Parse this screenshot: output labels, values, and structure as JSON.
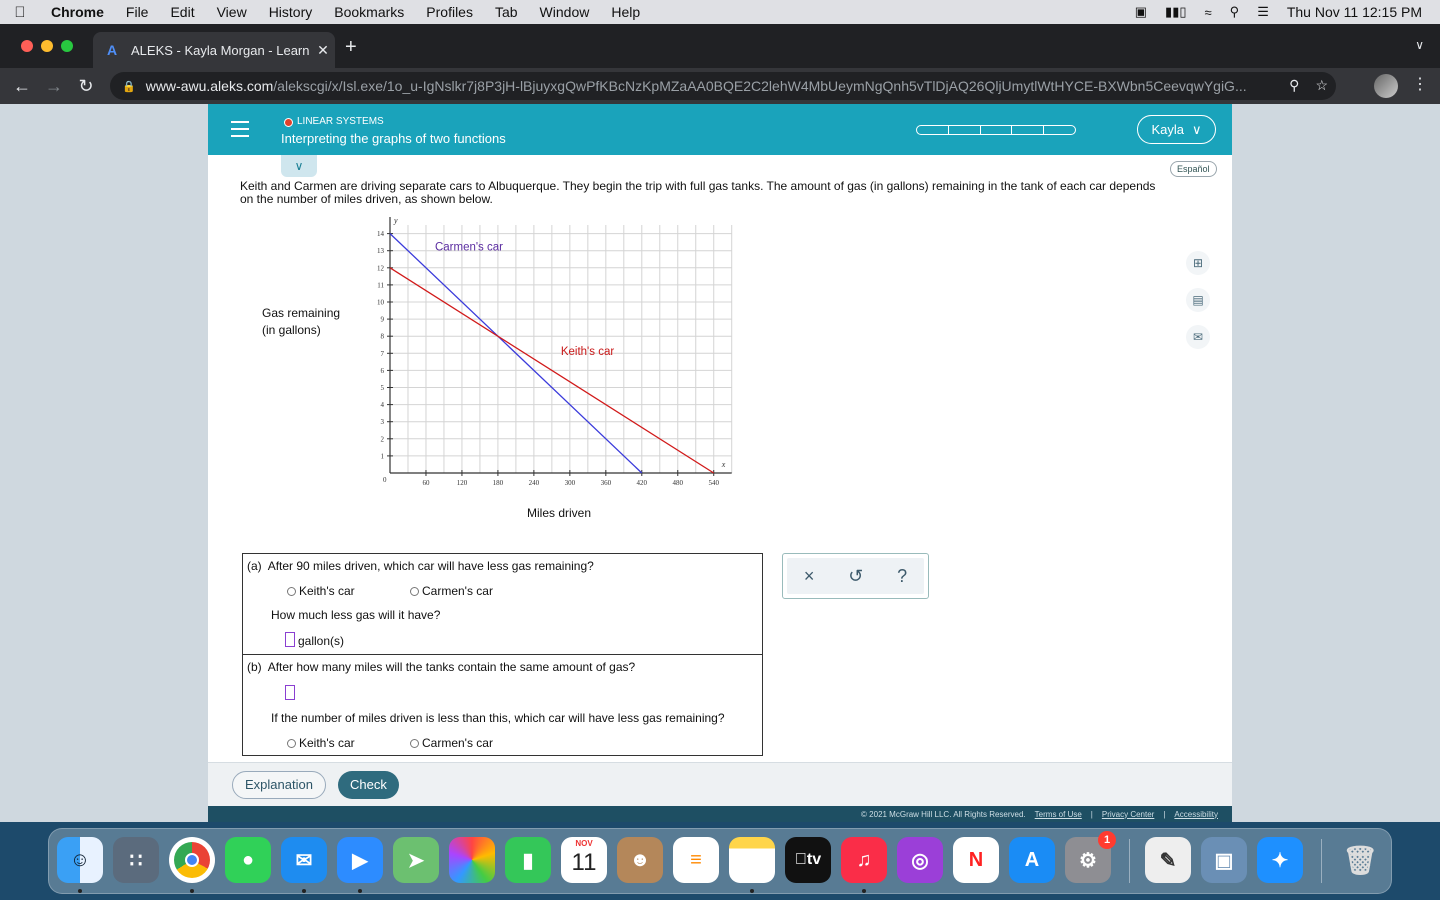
{
  "menubar": {
    "app": "Chrome",
    "items": [
      "File",
      "Edit",
      "View",
      "History",
      "Bookmarks",
      "Profiles",
      "Tab",
      "Window",
      "Help"
    ],
    "datetime": "Thu Nov 11  12:15 PM"
  },
  "browser": {
    "tab_title": "ALEKS - Kayla Morgan - Learn",
    "url_host": "www-awu.aleks.com",
    "url_path": "/alekscgi/x/Isl.exe/1o_u-IgNslkr7j8P3jH-lBjuyxgQwPfKBcNzKpMZaAA0BQE2C2lehW4MbUeymNgQnh5vTlDjAQ26QljUmytlWtHYCE-BXWbn5CeevqwYgiG..."
  },
  "aleks": {
    "topic_label": "LINEAR SYSTEMS",
    "topic_title": "Interpreting the graphs of two functions",
    "user_name": "Kayla",
    "espanol": "Español",
    "progress_segments": 5,
    "accent_color": "#1aa3bb"
  },
  "problem": {
    "text": "Keith and Carmen are driving separate cars to Albuquerque. They begin the trip with full gas tanks. The amount of gas (in gallons) remaining in the tank of each car depends on the number of miles driven, as shown below.",
    "y_axis_label_line1": "Gas remaining",
    "y_axis_label_line2": "(in gallons)",
    "x_axis_label": "Miles driven"
  },
  "chart_data": {
    "type": "line",
    "xlabel": "Miles driven",
    "ylabel": "Gas remaining (in gallons)",
    "x_axis_letter": "x",
    "y_axis_letter": "y",
    "origin_label": "0",
    "xlim": [
      0,
      570
    ],
    "ylim": [
      0,
      14.5
    ],
    "x_ticks": [
      60,
      120,
      180,
      240,
      300,
      360,
      420,
      480,
      540
    ],
    "y_ticks": [
      1,
      2,
      3,
      4,
      5,
      6,
      7,
      8,
      9,
      10,
      11,
      12,
      13,
      14
    ],
    "grid_step_x": 30,
    "grid_step_y": 1,
    "grid": true,
    "series": [
      {
        "name": "Carmen's car",
        "color": "#3b3bdb",
        "label_color": "#5a2ca0",
        "points": [
          [
            0,
            14
          ],
          [
            420,
            0
          ]
        ],
        "label_at": [
          75,
          13
        ]
      },
      {
        "name": "Keith's car",
        "color": "#d11a1a",
        "label_color": "#c81818",
        "points": [
          [
            0,
            12
          ],
          [
            540,
            0
          ]
        ],
        "label_at": [
          285,
          6.9
        ]
      }
    ]
  },
  "answers": {
    "part_a": {
      "label": "(a)",
      "question": "After 90 miles driven, which car will have less gas remaining?",
      "option_1": "Keith's car",
      "option_2": "Carmen's car",
      "followup": "How much less gas will it have?",
      "unit": "gallon(s)"
    },
    "part_b": {
      "label": "(b)",
      "question": "After how many miles will the tanks contain the same amount of gas?",
      "followup": "If the number of miles driven is less than this, which car will have less gas remaining?",
      "option_1": "Keith's car",
      "option_2": "Carmen's car"
    }
  },
  "tools": {
    "clear": "×",
    "undo": "↺",
    "help": "?"
  },
  "buttons": {
    "explanation": "Explanation",
    "check": "Check"
  },
  "footer": {
    "copyright": "© 2021 McGraw Hill LLC. All Rights Reserved.",
    "terms": "Terms of Use",
    "privacy": "Privacy Center",
    "accessibility": "Accessibility",
    "sep": "|"
  },
  "dock": {
    "calendar_month": "NOV",
    "calendar_day": "11",
    "tv_label": "tv",
    "settings_badge": "1"
  }
}
